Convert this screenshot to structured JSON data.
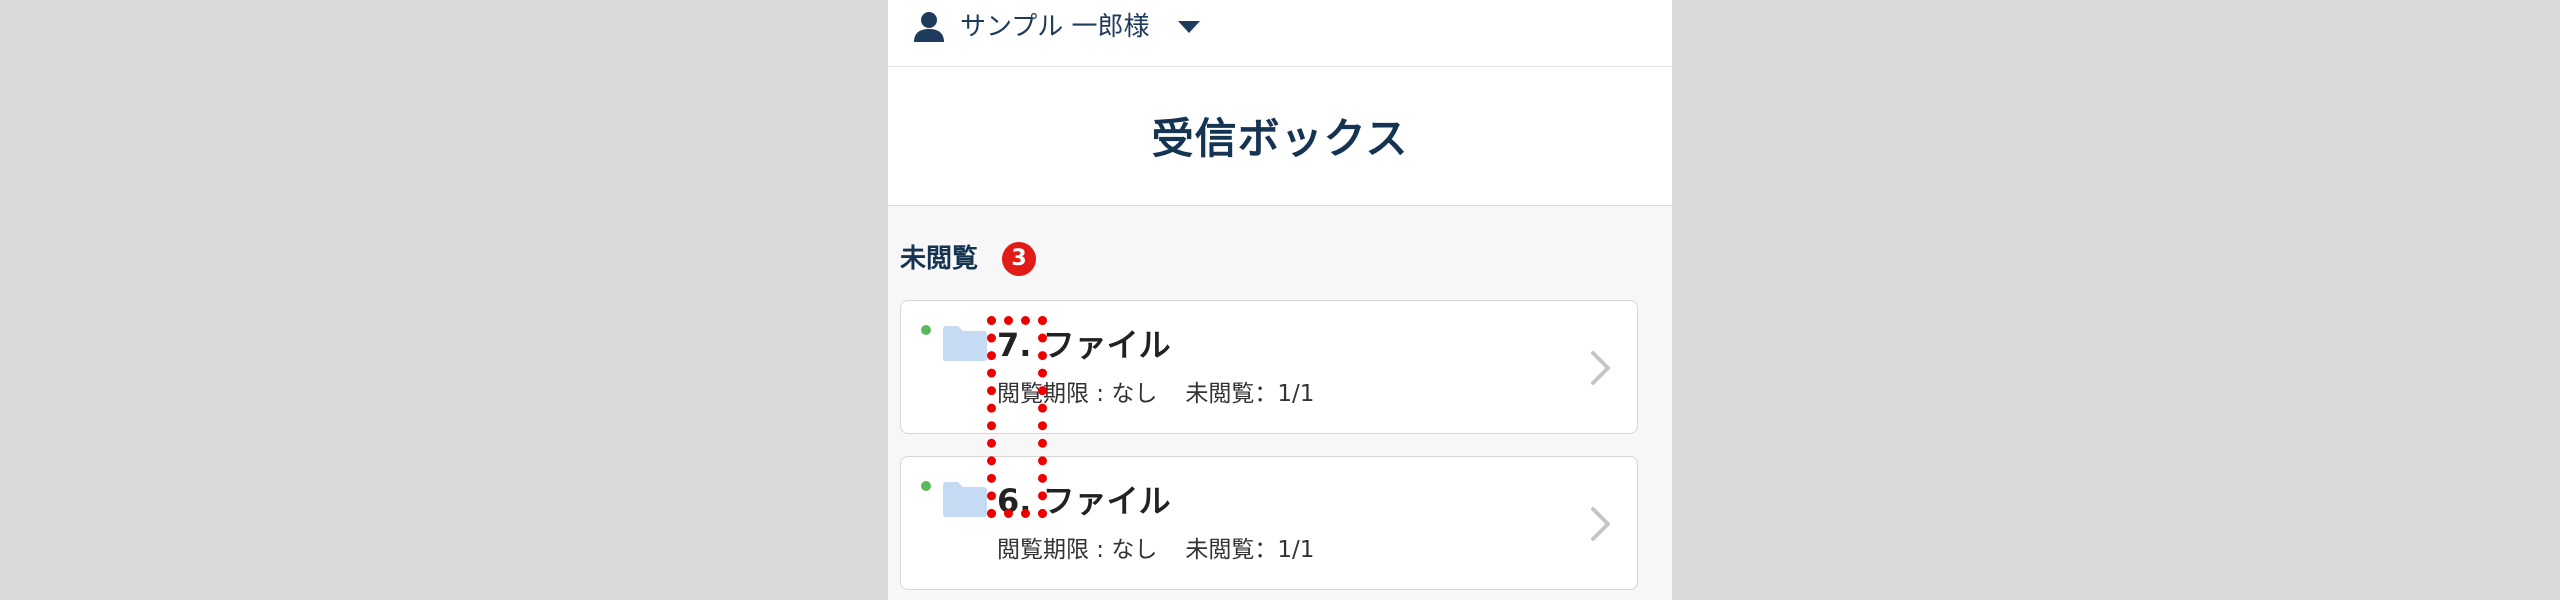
{
  "header": {
    "user_name": "サンプル 一郎様"
  },
  "page": {
    "title": "受信ボックス"
  },
  "unread_section": {
    "label": "未閲覧",
    "count": "3"
  },
  "items": [
    {
      "name": "7. ファイル",
      "deadline": "閲覧期限 : なし",
      "unread": "未閲覧：1/1",
      "unread_dot": true
    },
    {
      "name": "6. ファイル",
      "deadline": "閲覧期限 : なし",
      "unread": "未閲覧：1/1",
      "unread_dot": true
    }
  ],
  "colors": {
    "brand_navy": "#153452",
    "badge_red": "#e11b16",
    "unread_dot_green": "#5cb85c",
    "folder_blue": "#c5dbf3",
    "highlight_red": "#ee0000"
  }
}
